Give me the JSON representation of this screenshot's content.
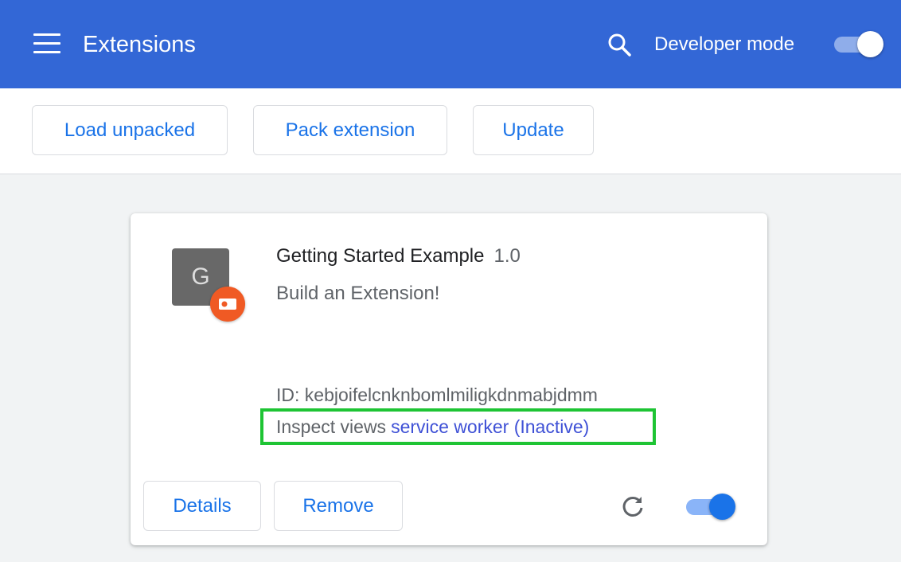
{
  "header": {
    "title": "Extensions",
    "search_icon": "search-icon",
    "developer_mode_label": "Developer mode",
    "developer_mode_on": true,
    "color": "#3367d6"
  },
  "toolbar": {
    "load_unpacked": "Load unpacked",
    "pack_extension": "Pack extension",
    "update": "Update"
  },
  "extension": {
    "icon_letter": "G",
    "name": "Getting Started Example",
    "version": "1.0",
    "description": "Build an Extension!",
    "id": "ID: kebjoifelcnknbomlmiligkdnmabjdmm",
    "inspect_label": "Inspect views",
    "inspect_link": "service worker (Inactive)",
    "details": "Details",
    "remove": "Remove",
    "enabled": true
  }
}
